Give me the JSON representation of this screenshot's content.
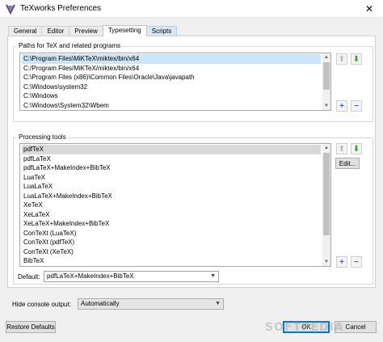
{
  "window": {
    "title": "TeXworks Preferences",
    "close_glyph": "✕"
  },
  "tabs": [
    {
      "label": "General"
    },
    {
      "label": "Editor"
    },
    {
      "label": "Preview"
    },
    {
      "label": "Typesetting"
    },
    {
      "label": "Scripts"
    }
  ],
  "paths_group": {
    "title": "Paths for TeX and related programs",
    "items": [
      "C:\\Program Files\\MiKTeX\\miktex/bin/x64",
      "C:/Program Files/MiKTeX/miktex/bin/x64",
      "C:\\Program Files (x86)\\Common Files\\Oracle\\Java\\javapath",
      "C:\\Windows\\system32",
      "C:\\Windows",
      "C:\\Windows\\System32\\Wbem"
    ]
  },
  "tools_group": {
    "title": "Processing tools",
    "items": [
      "pdfTeX",
      "pdfLaTeX",
      "pdfLaTeX+MakeIndex+BibTeX",
      "LuaTeX",
      "LuaLaTeX",
      "LuaLaTeX+MakeIndex+BibTeX",
      "XeTeX",
      "XeLaTeX",
      "XeLaTeX+MakeIndex+BibTeX",
      "ConTeXt (LuaTeX)",
      "ConTeXt (pdfTeX)",
      "ConTeXt (XeTeX)",
      "BibTeX"
    ],
    "edit_label": "Edit...",
    "default_label": "Default:",
    "default_value": "pdfLaTeX+MakeIndex+BibTeX"
  },
  "console": {
    "label": "Hide console output:",
    "value": "Automatically"
  },
  "buttons": {
    "restore": "Restore Defaults",
    "ok": "OK",
    "cancel": "Cancel"
  },
  "colors": {
    "selection": "#cce4f7",
    "green_arrow": "#3aa02e",
    "blue_button": "#2f6fd0",
    "default_button_border": "#0078d7"
  },
  "watermark": "SOFTPEDIA"
}
